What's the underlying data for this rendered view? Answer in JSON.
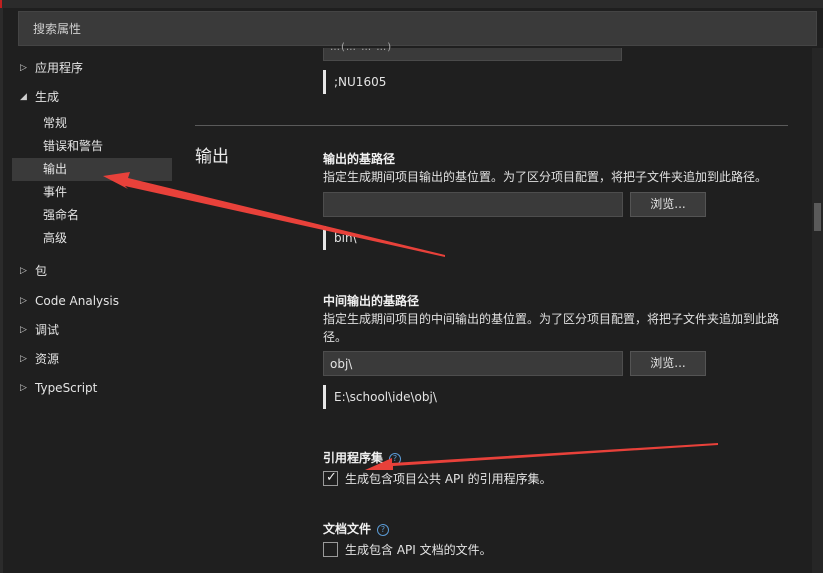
{
  "search": {
    "placeholder": "搜索属性"
  },
  "nav": {
    "items": [
      {
        "label": "应用程序",
        "expanded": false
      },
      {
        "label": "生成",
        "expanded": true
      },
      {
        "label": "常规"
      },
      {
        "label": "错误和警告"
      },
      {
        "label": "输出",
        "selected": true
      },
      {
        "label": "事件"
      },
      {
        "label": "强命名"
      },
      {
        "label": "高级"
      },
      {
        "label": "包",
        "expanded": false
      },
      {
        "label": "Code Analysis",
        "expanded": false
      },
      {
        "label": "调试",
        "expanded": false
      },
      {
        "label": "资源",
        "expanded": false
      },
      {
        "label": "TypeScript",
        "expanded": false
      }
    ]
  },
  "prev": {
    "value_fragment": "…(… … …)",
    "evaluated": ";NU1605"
  },
  "section": {
    "title": "输出"
  },
  "base_output": {
    "heading": "输出的基路径",
    "description": "指定生成期间项目输出的基位置。为了区分项目配置，将把子文件夹追加到此路径。",
    "value": "",
    "browse": "浏览...",
    "evaluated": "bin\\"
  },
  "intermediate_output": {
    "heading": "中间输出的基路径",
    "description": "指定生成期间项目的中间输出的基位置。为了区分项目配置，将把子文件夹追加到此路径。",
    "value": "obj\\",
    "browse": "浏览...",
    "evaluated": "E:\\school\\ide\\obj\\"
  },
  "reference_assembly": {
    "heading": "引用程序集",
    "help": "?",
    "checkbox_label": "生成包含项目公共 API 的引用程序集。",
    "checked": true
  },
  "documentation_file": {
    "heading": "文档文件",
    "help": "?",
    "checkbox_label": "生成包含 API 文档的文件。",
    "checked": false
  },
  "colors": {
    "background": "#1f1f1f",
    "panel": "#3a3a3a",
    "arrow": "#e8413a",
    "help_icon": "#5b9bd5"
  }
}
